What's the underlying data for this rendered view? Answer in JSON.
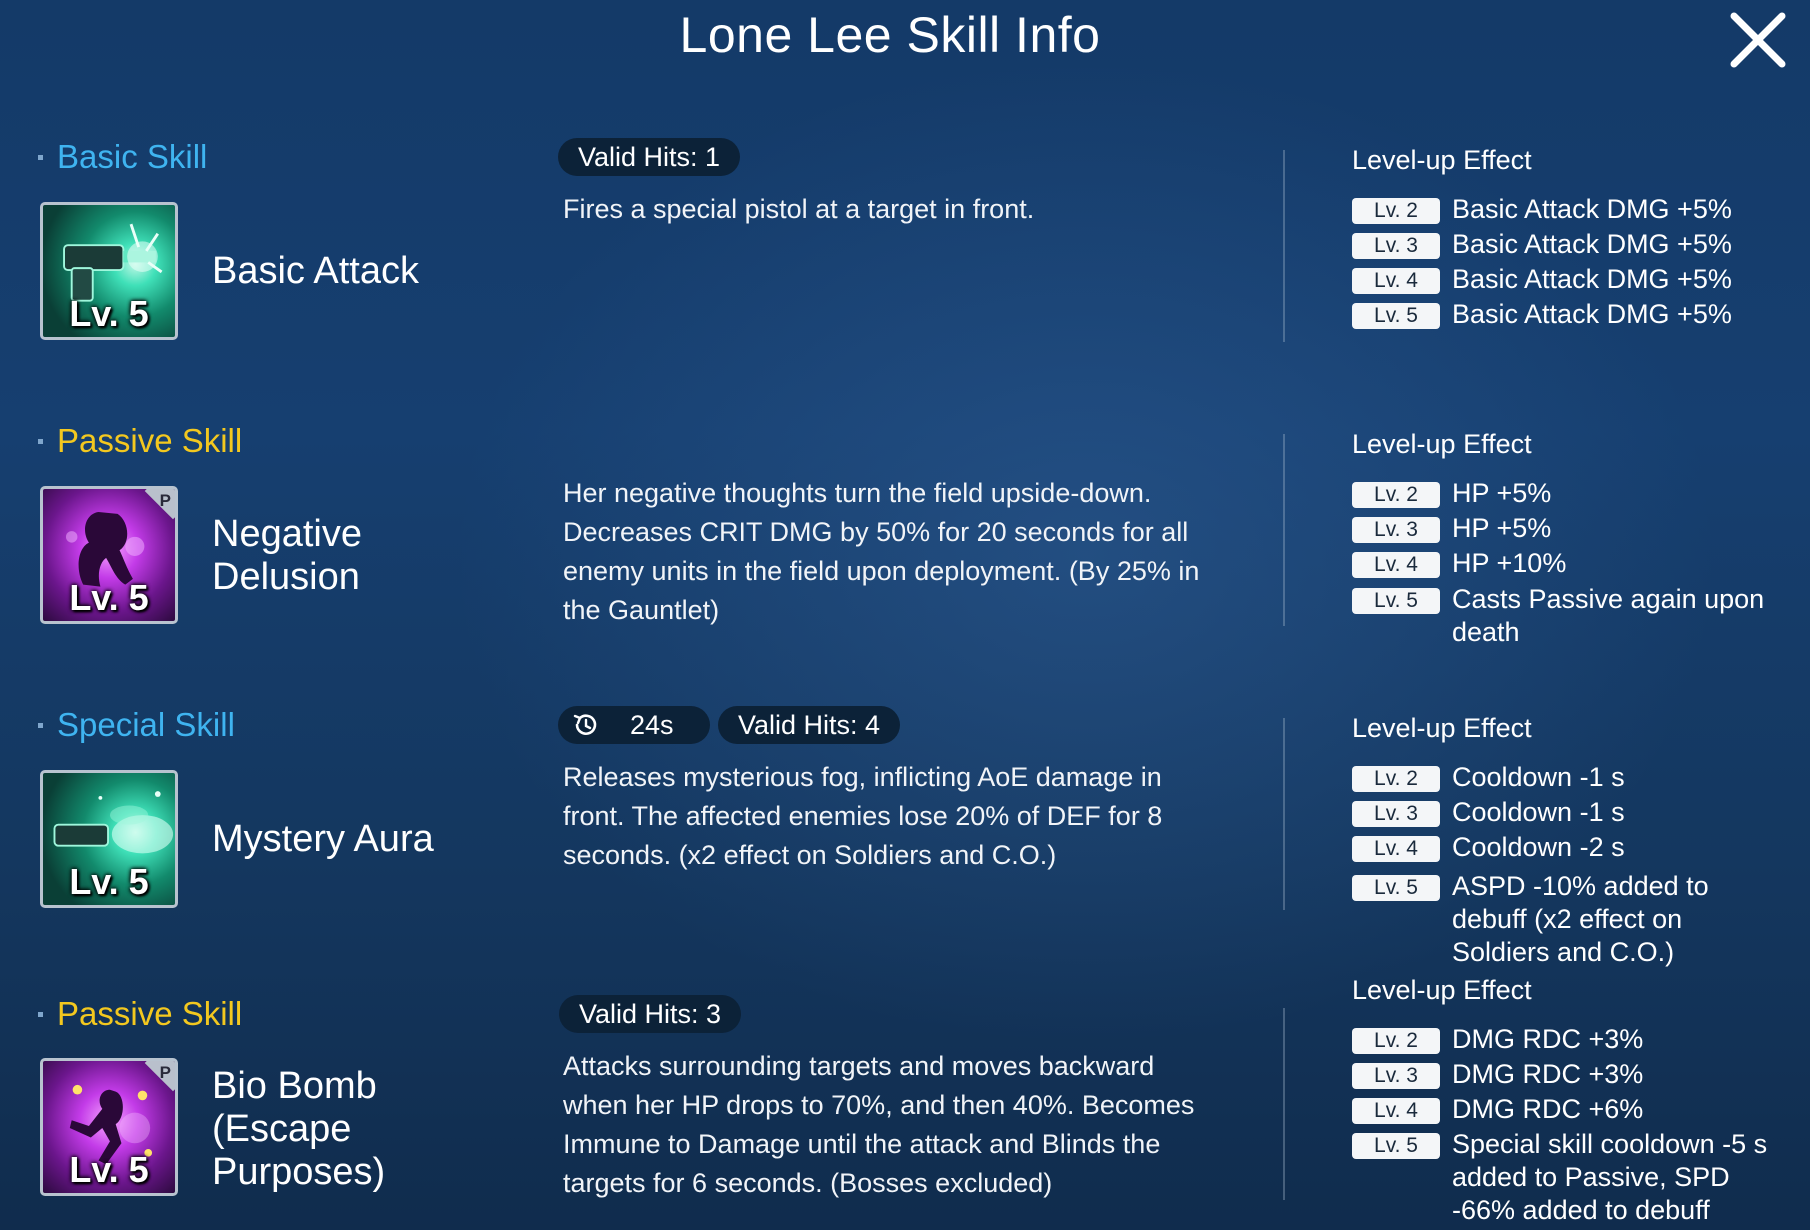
{
  "title": "Lone Lee Skill Info",
  "skills": [
    {
      "category": "Basic Skill",
      "name": "Basic Attack",
      "icon_level": "Lv. 5",
      "icon": "pistol-icon",
      "valid_hits": "Valid Hits: 1",
      "description": "Fires a special pistol at a target in front.",
      "levelup_title": "Level-up Effect",
      "levels": [
        {
          "tag": "Lv. 2",
          "text": "Basic Attack DMG +5%"
        },
        {
          "tag": "Lv. 3",
          "text": "Basic Attack DMG +5%"
        },
        {
          "tag": "Lv. 4",
          "text": "Basic Attack DMG +5%"
        },
        {
          "tag": "Lv. 5",
          "text": "Basic Attack DMG +5%"
        }
      ]
    },
    {
      "category": "Passive Skill",
      "name_line1": "Negative",
      "name_line2": "Delusion",
      "icon_level": "Lv. 5",
      "icon_badge": "P",
      "icon": "silhouette-icon",
      "description": "Her negative thoughts turn the field upside-down. Decreases CRIT DMG by 50% for 20 seconds for all enemy units in the field upon deployment. (By 25% in the Gauntlet)",
      "levelup_title": "Level-up Effect",
      "levels": [
        {
          "tag": "Lv. 2",
          "text": "HP +5%"
        },
        {
          "tag": "Lv. 3",
          "text": "HP +5%"
        },
        {
          "tag": "Lv. 4",
          "text": "HP +10%"
        },
        {
          "tag": "Lv. 5",
          "text": "Casts Passive again upon death"
        }
      ]
    },
    {
      "category": "Special Skill",
      "name": "Mystery Aura",
      "icon_level": "Lv. 5",
      "icon": "fog-pistol-icon",
      "cooldown": "24s",
      "valid_hits": "Valid Hits: 4",
      "description": "Releases mysterious fog, inflicting AoE damage in front. The affected enemies lose 20% of DEF for 8 seconds. (x2 effect on Soldiers and C.O.)",
      "levelup_title": "Level-up Effect",
      "levels": [
        {
          "tag": "Lv. 2",
          "text": "Cooldown -1 s"
        },
        {
          "tag": "Lv. 3",
          "text": "Cooldown -1 s"
        },
        {
          "tag": "Lv. 4",
          "text": "Cooldown -2 s"
        },
        {
          "tag": "Lv. 5",
          "text": "ASPD -10% added to debuff (x2 effect on Soldiers and C.O.)"
        }
      ]
    },
    {
      "category": "Passive Skill",
      "name_line1": "Bio Bomb",
      "name_line2": "(Escape",
      "name_line3": "Purposes)",
      "icon_level": "Lv. 5",
      "icon_badge": "P",
      "icon": "leaping-figure-icon",
      "valid_hits": "Valid Hits: 3",
      "description": "Attacks surrounding targets and moves backward when her HP drops to 70%, and then 40%. Becomes Immune to Damage until the attack and Blinds the targets for 6 seconds. (Bosses excluded)",
      "levelup_title": "Level-up Effect",
      "levels": [
        {
          "tag": "Lv. 2",
          "text": "DMG RDC +3%"
        },
        {
          "tag": "Lv. 3",
          "text": "DMG RDC +3%"
        },
        {
          "tag": "Lv. 4",
          "text": "DMG RDC +6%"
        },
        {
          "tag": "Lv. 5",
          "text": "Special skill cooldown -5 s added to Passive, SPD -66% added to debuff"
        }
      ]
    }
  ],
  "colors": {
    "basic_category": "#3fb4f0",
    "passive_category": "#f3c81f",
    "special_category": "#3fb4f0"
  }
}
